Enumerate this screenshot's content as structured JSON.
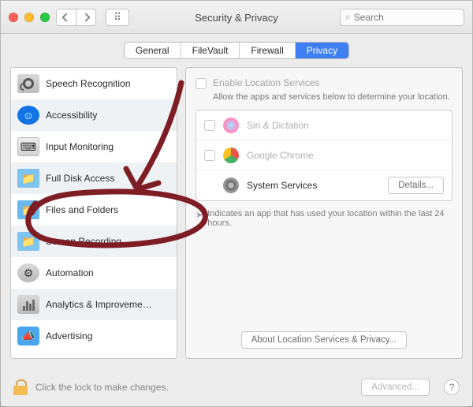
{
  "window": {
    "title": "Security & Privacy",
    "search_placeholder": "Search"
  },
  "tabs": [
    "General",
    "FileVault",
    "Firewall",
    "Privacy"
  ],
  "active_tab": 3,
  "sidebar": {
    "items": [
      {
        "label": "Speech Recognition"
      },
      {
        "label": "Accessibility"
      },
      {
        "label": "Input Monitoring"
      },
      {
        "label": "Full Disk Access"
      },
      {
        "label": "Files and Folders"
      },
      {
        "label": "Screen Recording"
      },
      {
        "label": "Automation"
      },
      {
        "label": "Analytics & Improveme…"
      },
      {
        "label": "Advertising"
      }
    ]
  },
  "privacy_panel": {
    "enable_label": "Enable Location Services",
    "enable_desc": "Allow the apps and services below to determine your location.",
    "apps": [
      {
        "name": "Siri & Dictation",
        "checkbox": true,
        "enabled": false
      },
      {
        "name": "Google Chrome",
        "checkbox": true,
        "enabled": false
      },
      {
        "name": "System Services",
        "checkbox": false,
        "enabled": true,
        "action": "Details..."
      }
    ],
    "hint": "Indicates an app that has used your location within the last 24 hours.",
    "about_button": "About Location Services & Privacy..."
  },
  "footer": {
    "lock_text": "Click the lock to make changes.",
    "advanced": "Advanced...",
    "help": "?"
  },
  "annotation": {
    "highlighted_item": "Files and Folders"
  }
}
